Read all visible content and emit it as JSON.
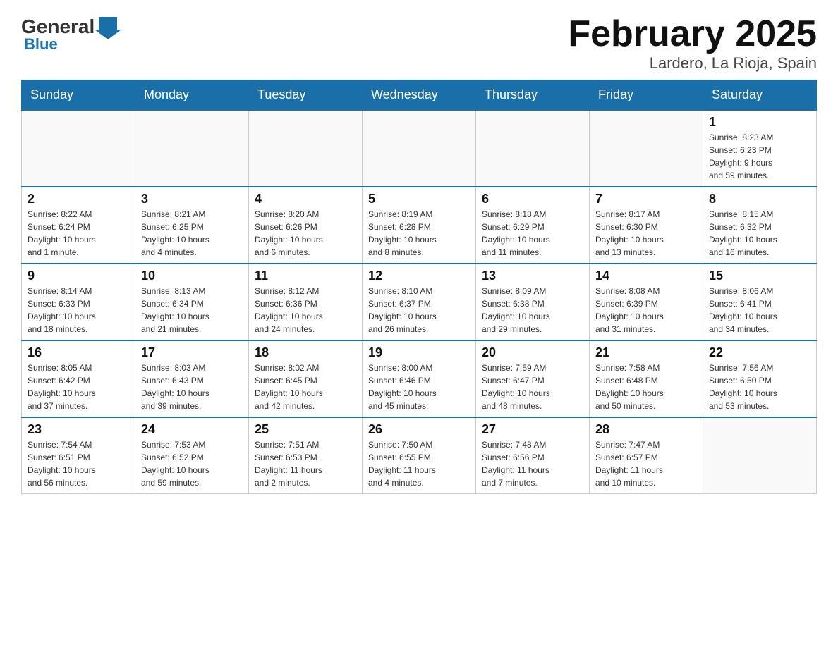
{
  "header": {
    "logo_general": "General",
    "logo_blue": "Blue",
    "title": "February 2025",
    "subtitle": "Lardero, La Rioja, Spain"
  },
  "weekdays": [
    "Sunday",
    "Monday",
    "Tuesday",
    "Wednesday",
    "Thursday",
    "Friday",
    "Saturday"
  ],
  "weeks": [
    [
      {
        "day": "",
        "info": ""
      },
      {
        "day": "",
        "info": ""
      },
      {
        "day": "",
        "info": ""
      },
      {
        "day": "",
        "info": ""
      },
      {
        "day": "",
        "info": ""
      },
      {
        "day": "",
        "info": ""
      },
      {
        "day": "1",
        "info": "Sunrise: 8:23 AM\nSunset: 6:23 PM\nDaylight: 9 hours\nand 59 minutes."
      }
    ],
    [
      {
        "day": "2",
        "info": "Sunrise: 8:22 AM\nSunset: 6:24 PM\nDaylight: 10 hours\nand 1 minute."
      },
      {
        "day": "3",
        "info": "Sunrise: 8:21 AM\nSunset: 6:25 PM\nDaylight: 10 hours\nand 4 minutes."
      },
      {
        "day": "4",
        "info": "Sunrise: 8:20 AM\nSunset: 6:26 PM\nDaylight: 10 hours\nand 6 minutes."
      },
      {
        "day": "5",
        "info": "Sunrise: 8:19 AM\nSunset: 6:28 PM\nDaylight: 10 hours\nand 8 minutes."
      },
      {
        "day": "6",
        "info": "Sunrise: 8:18 AM\nSunset: 6:29 PM\nDaylight: 10 hours\nand 11 minutes."
      },
      {
        "day": "7",
        "info": "Sunrise: 8:17 AM\nSunset: 6:30 PM\nDaylight: 10 hours\nand 13 minutes."
      },
      {
        "day": "8",
        "info": "Sunrise: 8:15 AM\nSunset: 6:32 PM\nDaylight: 10 hours\nand 16 minutes."
      }
    ],
    [
      {
        "day": "9",
        "info": "Sunrise: 8:14 AM\nSunset: 6:33 PM\nDaylight: 10 hours\nand 18 minutes."
      },
      {
        "day": "10",
        "info": "Sunrise: 8:13 AM\nSunset: 6:34 PM\nDaylight: 10 hours\nand 21 minutes."
      },
      {
        "day": "11",
        "info": "Sunrise: 8:12 AM\nSunset: 6:36 PM\nDaylight: 10 hours\nand 24 minutes."
      },
      {
        "day": "12",
        "info": "Sunrise: 8:10 AM\nSunset: 6:37 PM\nDaylight: 10 hours\nand 26 minutes."
      },
      {
        "day": "13",
        "info": "Sunrise: 8:09 AM\nSunset: 6:38 PM\nDaylight: 10 hours\nand 29 minutes."
      },
      {
        "day": "14",
        "info": "Sunrise: 8:08 AM\nSunset: 6:39 PM\nDaylight: 10 hours\nand 31 minutes."
      },
      {
        "day": "15",
        "info": "Sunrise: 8:06 AM\nSunset: 6:41 PM\nDaylight: 10 hours\nand 34 minutes."
      }
    ],
    [
      {
        "day": "16",
        "info": "Sunrise: 8:05 AM\nSunset: 6:42 PM\nDaylight: 10 hours\nand 37 minutes."
      },
      {
        "day": "17",
        "info": "Sunrise: 8:03 AM\nSunset: 6:43 PM\nDaylight: 10 hours\nand 39 minutes."
      },
      {
        "day": "18",
        "info": "Sunrise: 8:02 AM\nSunset: 6:45 PM\nDaylight: 10 hours\nand 42 minutes."
      },
      {
        "day": "19",
        "info": "Sunrise: 8:00 AM\nSunset: 6:46 PM\nDaylight: 10 hours\nand 45 minutes."
      },
      {
        "day": "20",
        "info": "Sunrise: 7:59 AM\nSunset: 6:47 PM\nDaylight: 10 hours\nand 48 minutes."
      },
      {
        "day": "21",
        "info": "Sunrise: 7:58 AM\nSunset: 6:48 PM\nDaylight: 10 hours\nand 50 minutes."
      },
      {
        "day": "22",
        "info": "Sunrise: 7:56 AM\nSunset: 6:50 PM\nDaylight: 10 hours\nand 53 minutes."
      }
    ],
    [
      {
        "day": "23",
        "info": "Sunrise: 7:54 AM\nSunset: 6:51 PM\nDaylight: 10 hours\nand 56 minutes."
      },
      {
        "day": "24",
        "info": "Sunrise: 7:53 AM\nSunset: 6:52 PM\nDaylight: 10 hours\nand 59 minutes."
      },
      {
        "day": "25",
        "info": "Sunrise: 7:51 AM\nSunset: 6:53 PM\nDaylight: 11 hours\nand 2 minutes."
      },
      {
        "day": "26",
        "info": "Sunrise: 7:50 AM\nSunset: 6:55 PM\nDaylight: 11 hours\nand 4 minutes."
      },
      {
        "day": "27",
        "info": "Sunrise: 7:48 AM\nSunset: 6:56 PM\nDaylight: 11 hours\nand 7 minutes."
      },
      {
        "day": "28",
        "info": "Sunrise: 7:47 AM\nSunset: 6:57 PM\nDaylight: 11 hours\nand 10 minutes."
      },
      {
        "day": "",
        "info": ""
      }
    ]
  ]
}
